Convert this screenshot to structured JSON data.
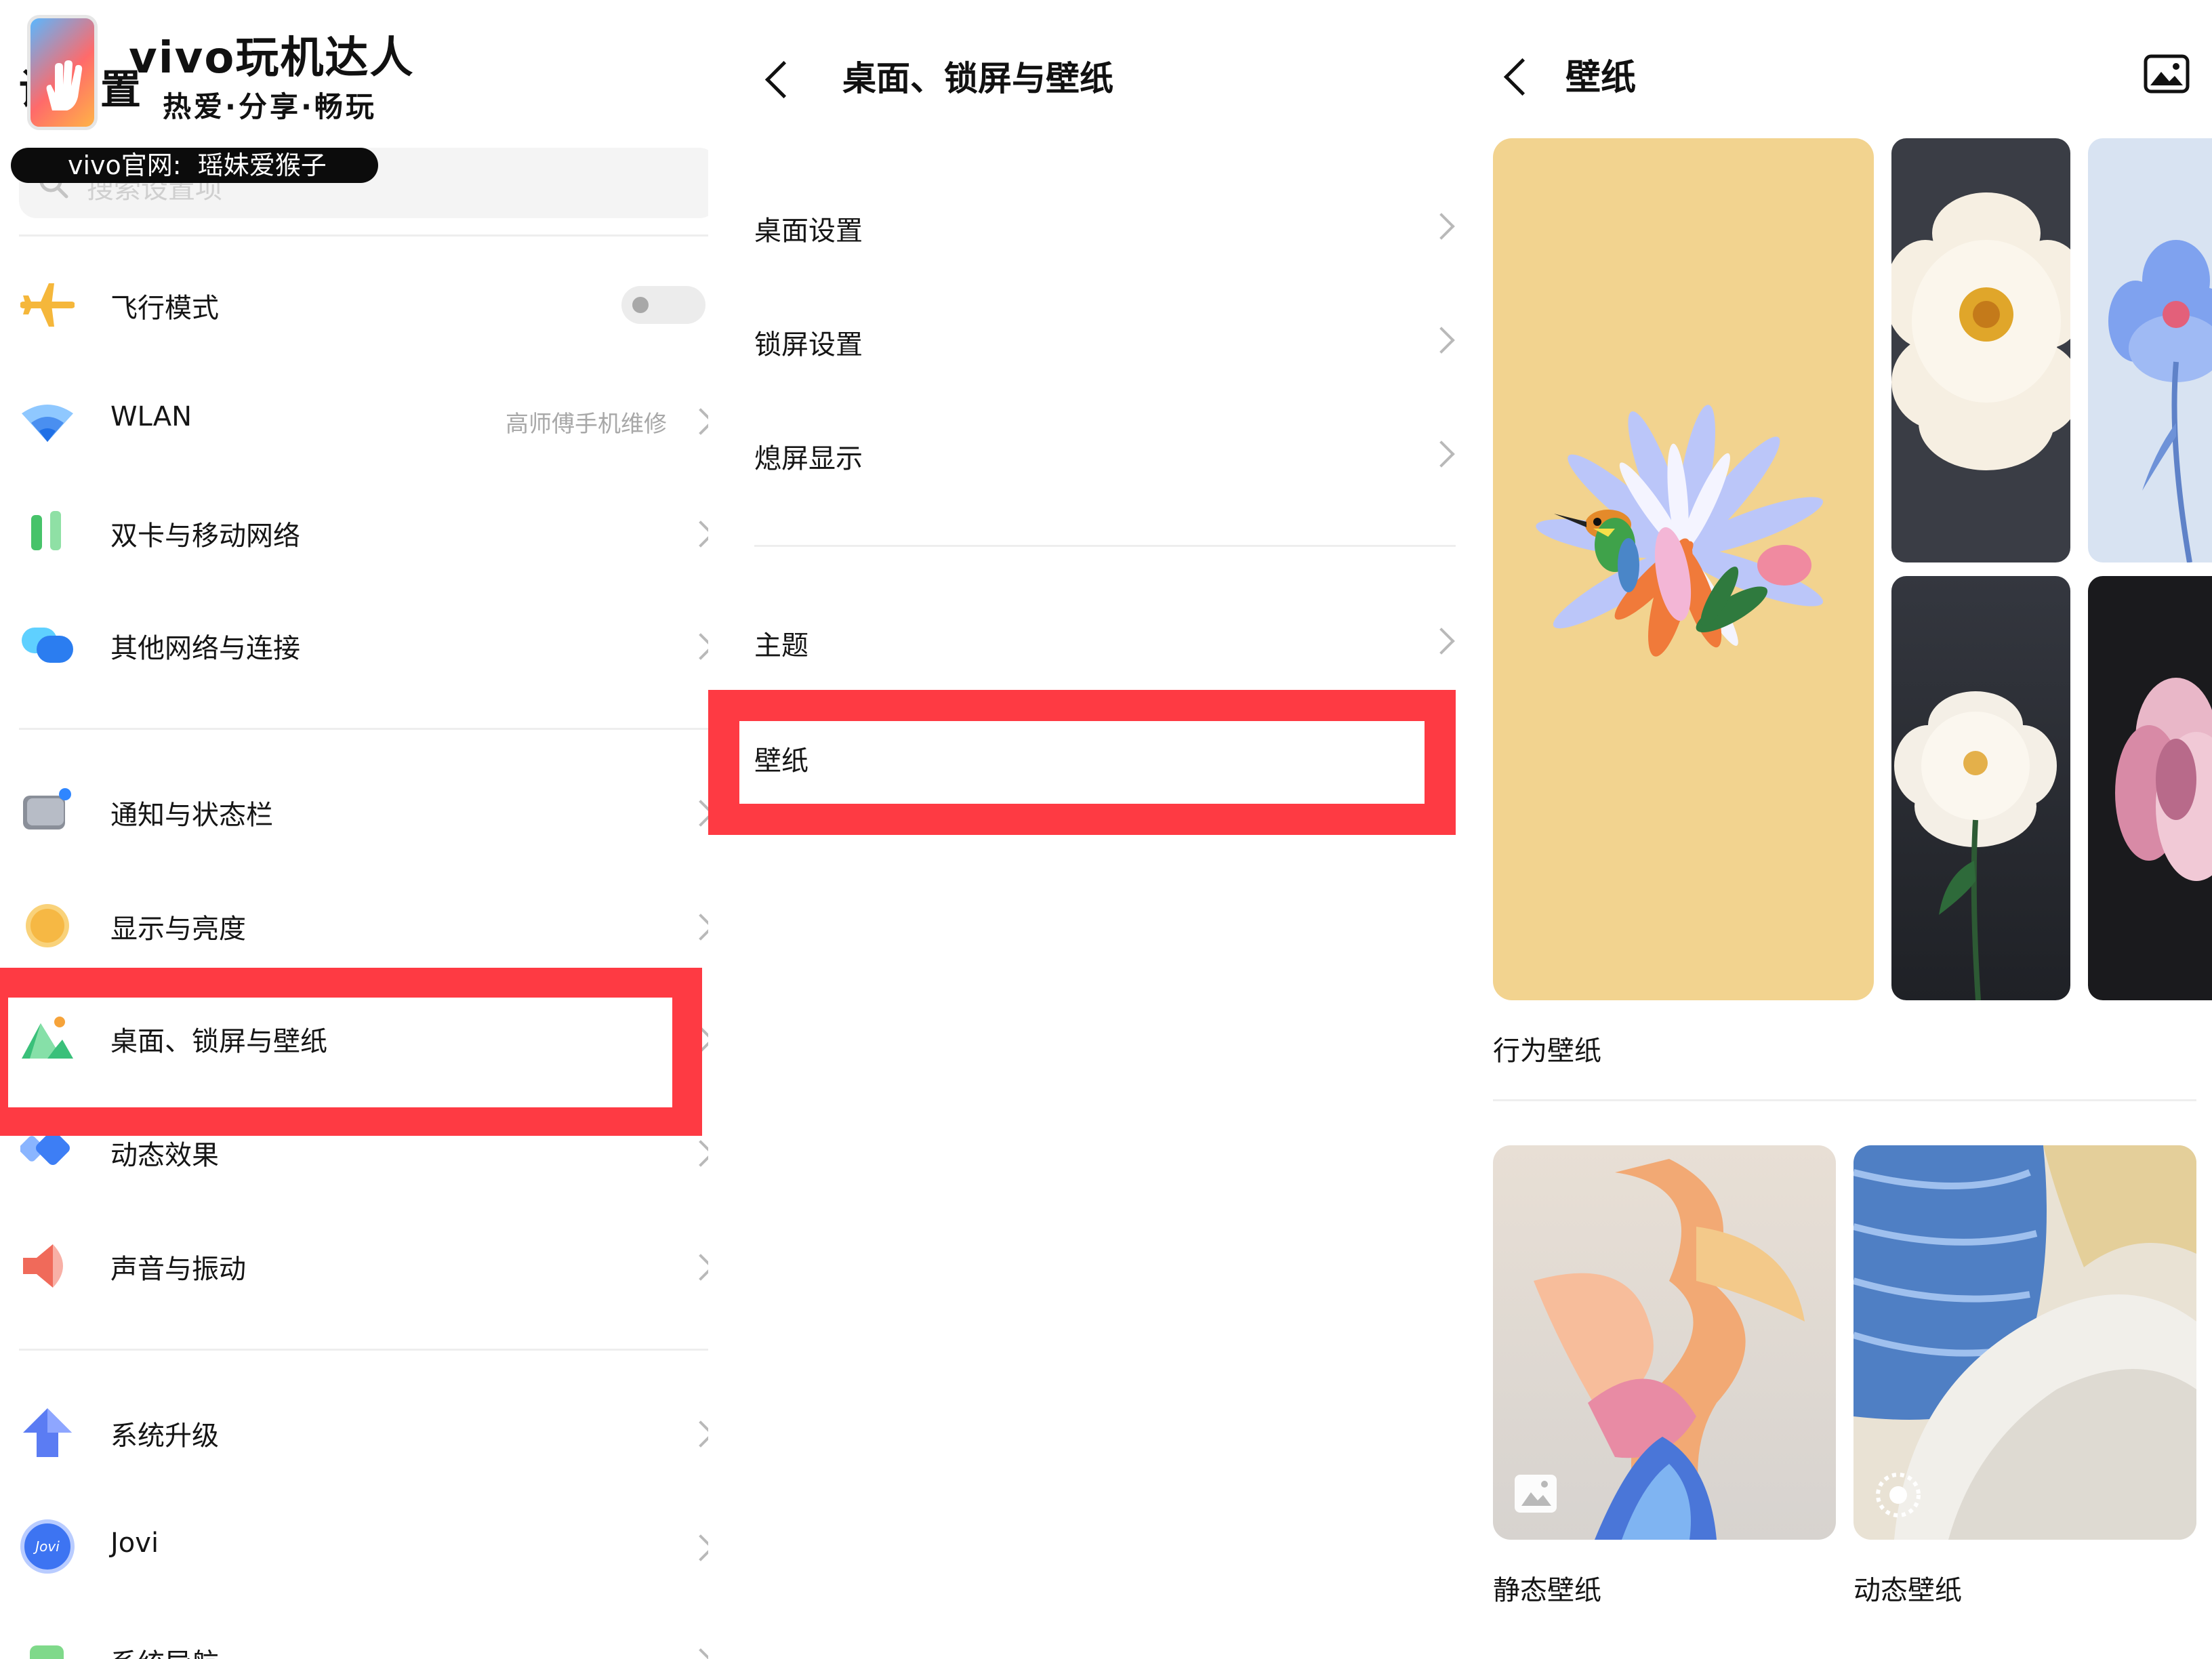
{
  "watermark": {
    "brand": "vivo玩机达人",
    "slogan": "热爱·分享·畅玩",
    "official": "vivo官网:  瑶妹爱猴子"
  },
  "settings": {
    "title_partial": "设置",
    "search_placeholder": "搜索设置项",
    "items": [
      {
        "label": "飞行模式",
        "icon": "airplane-icon",
        "toggle": false
      },
      {
        "label": "WLAN",
        "icon": "wifi-icon",
        "value": "高师傅手机维修"
      },
      {
        "label": "双卡与移动网络",
        "icon": "mobile-network-icon"
      },
      {
        "label": "其他网络与连接",
        "icon": "connections-icon"
      },
      {
        "label": "通知与状态栏",
        "icon": "notification-icon"
      },
      {
        "label": "显示与亮度",
        "icon": "brightness-icon"
      },
      {
        "label": "桌面、锁屏与壁纸",
        "icon": "wallpaper-mountain-icon",
        "highlighted": true
      },
      {
        "label": "动态效果",
        "icon": "motion-effect-icon"
      },
      {
        "label": "声音与振动",
        "icon": "speaker-icon"
      },
      {
        "label": "系统升级",
        "icon": "upgrade-arrow-icon"
      },
      {
        "label": "Jovi",
        "icon": "jovi-icon",
        "icon_text": "Jovi"
      },
      {
        "label": "系统导航",
        "icon": "navigation-icon"
      }
    ]
  },
  "desktop_page": {
    "title": "桌面、锁屏与壁纸",
    "items": [
      {
        "label": "桌面设置"
      },
      {
        "label": "锁屏设置"
      },
      {
        "label": "熄屏显示"
      },
      {
        "label": "主题"
      },
      {
        "label": "壁纸",
        "highlighted": true
      }
    ]
  },
  "wallpaper_page": {
    "title": "壁纸",
    "behavior_label": "行为壁纸",
    "static_label": "静态壁纸",
    "dynamic_label": "动态壁纸"
  },
  "colors": {
    "highlight_red": "#fe3a43",
    "behavior_bg": "#f2d38f",
    "chevron": "#b9b9b9"
  }
}
